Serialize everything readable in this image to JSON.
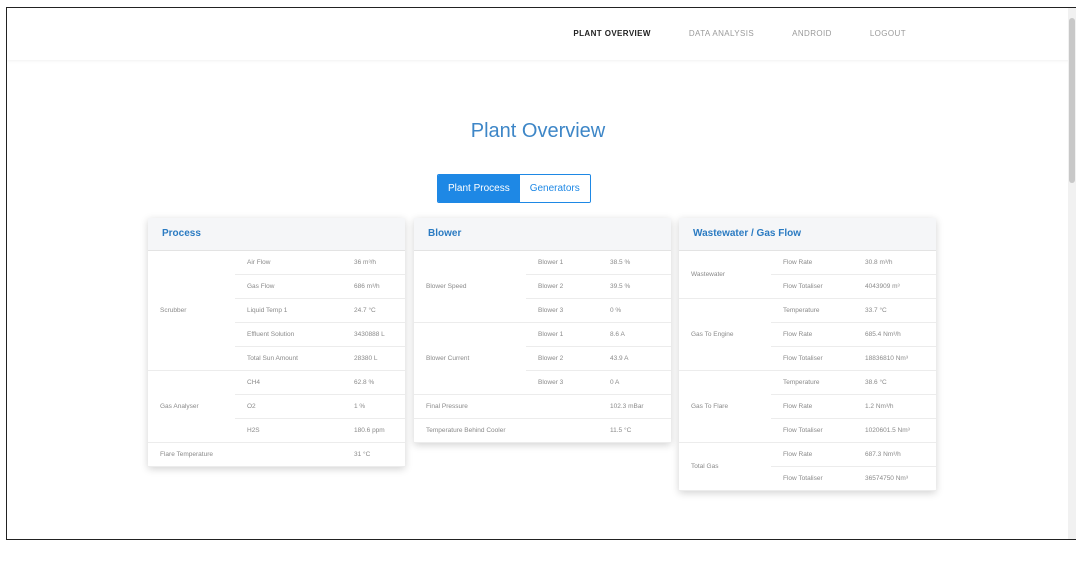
{
  "nav": {
    "items": [
      {
        "label": "PLANT OVERVIEW",
        "active": true
      },
      {
        "label": "DATA ANALYSIS",
        "active": false
      },
      {
        "label": "ANDROID",
        "active": false
      },
      {
        "label": "LOGOUT",
        "active": false
      }
    ]
  },
  "page": {
    "title": "Plant Overview",
    "toggle": {
      "left": "Plant Process",
      "right": "Generators"
    }
  },
  "process": {
    "header": "Process",
    "groups": [
      {
        "name": "Scrubber",
        "rows": [
          {
            "label": "Air Flow",
            "value": "36 m³/h"
          },
          {
            "label": "Gas Flow",
            "value": "686 m³/h"
          },
          {
            "label": "Liquid Temp 1",
            "value": "24.7 °C"
          },
          {
            "label": "Effluent Solution",
            "value": "3430888 L"
          },
          {
            "label": "Total Sun Amount",
            "value": "28380 L"
          }
        ]
      },
      {
        "name": "Gas Analyser",
        "rows": [
          {
            "label": "CH4",
            "value": "62.8 %"
          },
          {
            "label": "O2",
            "value": "1 %"
          },
          {
            "label": "H2S",
            "value": "180.6 ppm"
          }
        ]
      },
      {
        "name": "Flare Temperature",
        "rows": [
          {
            "label": "",
            "value": "31 °C"
          }
        ]
      }
    ]
  },
  "blower": {
    "header": "Blower",
    "groups": [
      {
        "name": "Blower Speed",
        "rows": [
          {
            "label": "Blower 1",
            "value": "38.5 %"
          },
          {
            "label": "Blower 2",
            "value": "39.5 %"
          },
          {
            "label": "Blower 3",
            "value": "0 %"
          }
        ]
      },
      {
        "name": "Blower Current",
        "rows": [
          {
            "label": "Blower 1",
            "value": "8.6 A"
          },
          {
            "label": "Blower 2",
            "value": "43.9 A"
          },
          {
            "label": "Blower 3",
            "value": "0 A"
          }
        ]
      },
      {
        "name": "Final Pressure",
        "rows": [
          {
            "label": "",
            "value": "102.3 mBar"
          }
        ]
      },
      {
        "name": "Temperature Behind Cooler",
        "rows": [
          {
            "label": "",
            "value": "11.5 °C"
          }
        ]
      }
    ]
  },
  "wastewater": {
    "header": "Wastewater / Gas Flow",
    "groups": [
      {
        "name": "Wastewater",
        "rows": [
          {
            "label": "Flow Rate",
            "value": "30.8 m³/h"
          },
          {
            "label": "Flow Totaliser",
            "value": "4043909 m³"
          }
        ]
      },
      {
        "name": "Gas To Engine",
        "rows": [
          {
            "label": "Temperature",
            "value": "33.7 °C"
          },
          {
            "label": "Flow Rate",
            "value": "685.4 Nm³/h"
          },
          {
            "label": "Flow Totaliser",
            "value": "18836810 Nm³"
          }
        ]
      },
      {
        "name": "Gas To Flare",
        "rows": [
          {
            "label": "Temperature",
            "value": "38.6 °C"
          },
          {
            "label": "Flow Rate",
            "value": "1.2 Nm³/h"
          },
          {
            "label": "Flow Totaliser",
            "value": "1020601.5 Nm³"
          }
        ]
      },
      {
        "name": "Total Gas",
        "rows": [
          {
            "label": "Flow Rate",
            "value": "687.3 Nm³/h"
          },
          {
            "label": "Flow Totaliser",
            "value": "36574750 Nm³"
          }
        ]
      }
    ]
  }
}
